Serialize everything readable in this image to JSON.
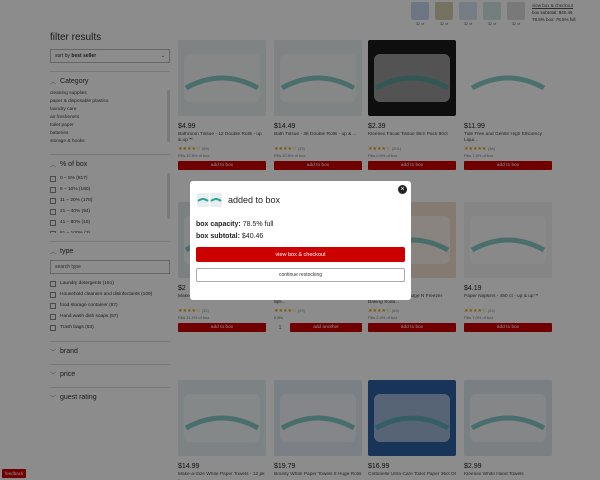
{
  "topbox": {
    "thumbs": [
      {
        "qty": "32 ct",
        "color": "#c9d7ef"
      },
      {
        "qty": "32 ct",
        "color": "#d8d0b0"
      },
      {
        "qty": "32 ct",
        "color": "#d8e3f0"
      },
      {
        "qty": "32 ct",
        "color": "#cfe7e5"
      },
      {
        "qty": "32 ct",
        "color": "#dddddd"
      }
    ],
    "link": "view box & checkout",
    "subtotal_line": "box subtotal: $40.46",
    "capacity_line": "78.5% box: 78.5% full"
  },
  "sidebar": {
    "title": "filter results",
    "sort": {
      "prefix": "sort by",
      "value": "best seller"
    },
    "category": {
      "label": "Category",
      "items": [
        "cleaning supplies",
        "paper & disposable plastics",
        "laundry care",
        "air fresheners",
        "toilet paper",
        "batteries",
        "storage & hooks"
      ]
    },
    "percent_box": {
      "label": "% of box",
      "items": [
        "0 – 5% (817)",
        "6 – 10% (180)",
        "11 – 20% (178)",
        "21 – 40% (94)",
        "41 – 80% (15)",
        "81 – 100% (3)"
      ]
    },
    "type": {
      "label": "type",
      "search_placeholder": "search type",
      "items": [
        "Laundry detergents (161)",
        "Household cleaners and disinfectants (109)",
        "food storage container (87)",
        "Hand wash dish soaps (57)",
        "Trash bags (53)"
      ]
    },
    "brand_label": "brand",
    "price_label": "price",
    "rating_label": "guest rating"
  },
  "products": [
    {
      "price": "$4.99",
      "name": "Bathroom Tissue - 12 Double Rolls - up & up™",
      "stars": "★★★★☆",
      "reviews": "(59)",
      "each": "Fills 12.5% of box",
      "button": "add to box",
      "color": "#e9eef0"
    },
    {
      "price": "$14.49",
      "name": "Bath Tissue - 36 Double Rolls - up & ...",
      "stars": "★★★★☆",
      "reviews": "(33)",
      "each": "Fills 40.5% of box",
      "button": "add to box",
      "color": "#e9eef0"
    },
    {
      "price": "$2.39",
      "name": "Kleenex Facial Tissue Slim Pack 80ct",
      "stars": "★★★★☆",
      "reviews": "(201)",
      "each": "Fills 0.6% of box",
      "button": "add to box",
      "color": "#1a1a1a"
    },
    {
      "price": "$11.99",
      "name": "Tide Free and Gentle High Efficiency Liqui...",
      "stars": "★★★★★",
      "reviews": "(38)",
      "each": "Fills 7.4% of box",
      "button": "add to box",
      "color": "#ffffff"
    },
    {
      "price": "$2",
      "name": "Make-A-Size White Paper Towels - 8pk...",
      "stars": "★★★★☆",
      "reviews": "(32)",
      "each": "Fills 11.4% of box",
      "button": "add to box",
      "color": "#e0ebe9"
    },
    {
      "price": "$",
      "name": "Giant Make-A-Size White Paper Towels - 8pk...",
      "stars": "★★★★☆",
      "reviews": "(29)",
      "each": "8 fills",
      "button": "add another",
      "qty": "1",
      "color": "#e0ebe9"
    },
    {
      "price": "$",
      "name": "Arm & Hammer® Fridge N Freezer Baking Soda...",
      "stars": "★★★★☆",
      "reviews": "(69)",
      "each": "Fills 2.4% of box",
      "button": "add to box",
      "color": "#f3dfd0"
    },
    {
      "price": "$4.19",
      "name": "Paper Napkins - 450 ct - up & up™",
      "stars": "★★★★☆",
      "reviews": "(22)",
      "each": "Fills 7.0% of box",
      "button": "add to box",
      "color": "#f2f2f2"
    },
    {
      "price": "$14.99",
      "name": "Make-a-Size White Paper Towels - 12 pk - ...",
      "stars": "★★★★☆",
      "reviews": "(77)",
      "each": "",
      "button": "add to box",
      "color": "#e4eef0"
    },
    {
      "price": "$19.79",
      "name": "Bounty White Paper Towels 8 Huge Rolls",
      "stars": "★★★★☆",
      "reviews": "(103)",
      "each": "",
      "button": "add to box",
      "color": "#dfe9f2"
    },
    {
      "price": "$16.99",
      "name": "Cottonelle Ultra Care Toilet Paper 36ct Dt",
      "stars": "★★★★☆",
      "reviews": "(48)",
      "each": "",
      "button": "add to box",
      "color": "#2c5fa3"
    },
    {
      "price": "$2.99",
      "name": "Kleenex White Hand Towels",
      "stars": "★★★★☆",
      "reviews": "(31)",
      "each": "",
      "button": "add to box",
      "color": "#dfe7f0"
    }
  ],
  "modal": {
    "title": "added to box",
    "capacity_label": "box capacity:",
    "capacity_value": "78.5% full",
    "subtotal_label": "box subtotal:",
    "subtotal_value": "$40.46",
    "checkout_label": "view box & checkout",
    "restock_label": "continue restocking"
  },
  "feedback_label": "feedback",
  "colors": {
    "accent": "#cc0000",
    "overlay": "rgba(0,0,0,0.45)"
  }
}
